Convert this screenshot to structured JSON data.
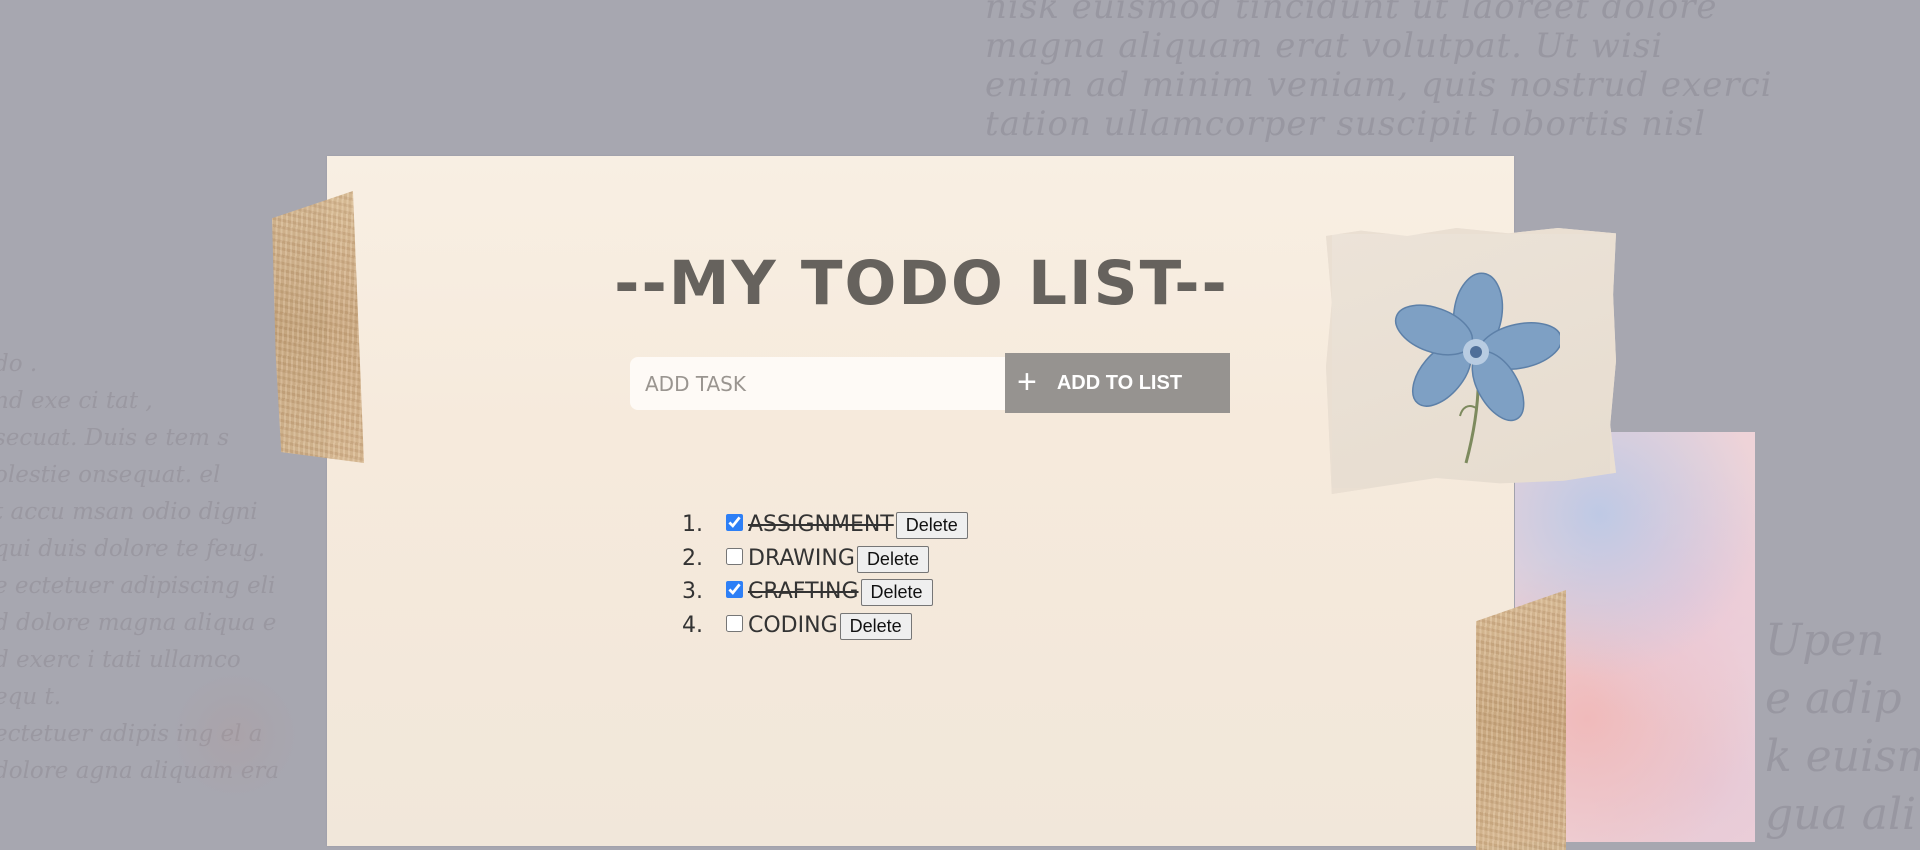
{
  "title": "--MY TODO LIST--",
  "form": {
    "input_placeholder": "ADD TASK",
    "input_value": "",
    "add_button_icon": "+",
    "add_button_label": "ADD TO LIST"
  },
  "tasks": [
    {
      "number": "1.",
      "text": "ASSIGNMENT",
      "checked": true,
      "delete_label": "Delete"
    },
    {
      "number": "2.",
      "text": "DRAWING",
      "checked": false,
      "delete_label": "Delete"
    },
    {
      "number": "3.",
      "text": "CRAFTING",
      "checked": true,
      "delete_label": "Delete"
    },
    {
      "number": "4.",
      "text": "CODING",
      "checked": false,
      "delete_label": "Delete"
    }
  ],
  "decor": {
    "script_top": "nisk euismod tincidunt ut laoreet dolore\nmagna aliquam erat volutpat. Ut wisi\nenim ad minim veniam, quis nostrud exerci\ntation ullamcorper suscipit lobortis nisl",
    "script_left": "do .\nnd exe ci tat ,\nsecuat. Duis e tem s\nolestie onsequat. el\nt accu msan odio digni\nqui duis dolore te feug.\ne ectetuer adipiscing eli\nd dolore magna aliqua e\nd exerc i tati ullamco\nequ t.\nectetuer adipis ing el a\ndolore agna aliquam era",
    "script_right": "Upen\ne adip\nk euism\ngua ali"
  },
  "colors": {
    "background": "#a7a7b0",
    "paper": "#f6eadc",
    "title": "#66625d",
    "add_button": "#969390",
    "checkbox_accent": "#2d7ff6"
  },
  "icons": {
    "add": "plus-icon",
    "flower": "flower-icon"
  }
}
